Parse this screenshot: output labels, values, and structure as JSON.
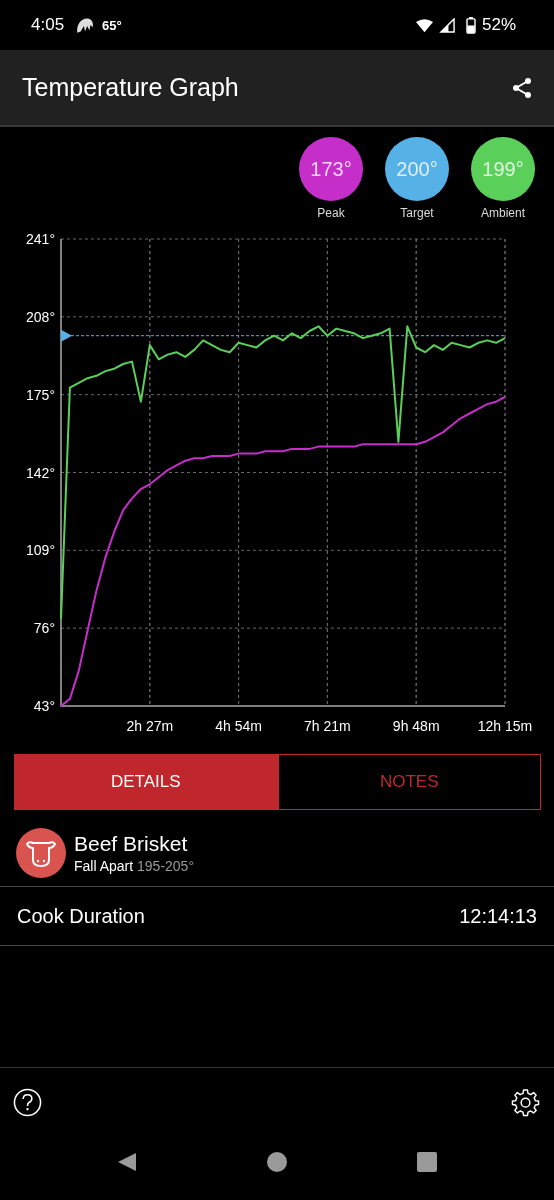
{
  "status_bar": {
    "time": "4:05",
    "temperature": "65°",
    "battery": "52%"
  },
  "app_bar": {
    "title": "Temperature Graph"
  },
  "readings": [
    {
      "value": "173°",
      "label": "Peak",
      "color": "#c62ec9"
    },
    {
      "value": "200°",
      "label": "Target",
      "color": "#55b1e6"
    },
    {
      "value": "199°",
      "label": "Ambient",
      "color": "#5ad05a"
    }
  ],
  "chart": {
    "chart_data": {
      "type": "line",
      "categories": [
        null,
        null,
        null,
        null,
        null,
        null,
        null,
        null,
        null,
        null,
        "2h 27m",
        null,
        null,
        null,
        null,
        null,
        null,
        null,
        null,
        null,
        "4h 54m",
        null,
        null,
        null,
        null,
        null,
        null,
        null,
        null,
        null,
        "7h 21m",
        null,
        null,
        null,
        null,
        null,
        null,
        null,
        null,
        null,
        "9h 48m",
        null,
        null,
        null,
        null,
        null,
        null,
        null,
        null,
        null,
        "12h 15m"
      ],
      "series": [
        {
          "color": "#5ad05a",
          "values": [
            80,
            178,
            180,
            182,
            183,
            185,
            186,
            188,
            189,
            172,
            196,
            190,
            192,
            193,
            191,
            194,
            198,
            196,
            194,
            193,
            197,
            196,
            195,
            198,
            200,
            198,
            201,
            199,
            202,
            204,
            200,
            203,
            202,
            201,
            199,
            200,
            201,
            203,
            155,
            204,
            195,
            193,
            196,
            194,
            197,
            196,
            195,
            197,
            198,
            197,
            199
          ]
        },
        {
          "color": "#c62ec9",
          "values": [
            43,
            46,
            58,
            75,
            92,
            106,
            117,
            126,
            131,
            135,
            137,
            140,
            143,
            145,
            147,
            148,
            148,
            149,
            149,
            149,
            150,
            150,
            150,
            151,
            151,
            151,
            152,
            152,
            152,
            153,
            153,
            153,
            153,
            153,
            154,
            154,
            154,
            154,
            154,
            154,
            154,
            155,
            157,
            159,
            162,
            165,
            167,
            169,
            171,
            172,
            174
          ]
        }
      ],
      "ylim": [
        43,
        241
      ],
      "grid": true,
      "yticks": [
        {
          "value": 43,
          "label": "43°"
        },
        {
          "value": 76,
          "label": "76°"
        },
        {
          "value": 109,
          "label": "109°"
        },
        {
          "value": 142,
          "label": "142°"
        },
        {
          "value": 175,
          "label": "175°"
        },
        {
          "value": 208,
          "label": "208°"
        },
        {
          "value": 241,
          "label": "241°"
        }
      ],
      "ref_lines": [
        {
          "axis": "y",
          "value": 200
        }
      ]
    }
  },
  "tabs": [
    {
      "label": "DETAILS",
      "selected": true
    },
    {
      "label": "NOTES",
      "selected": false
    }
  ],
  "food": {
    "name": "Beef Brisket",
    "doneness": "Fall Apart",
    "range": "195-205°"
  },
  "duration": {
    "label": "Cook Duration",
    "value": "12:14:13"
  }
}
